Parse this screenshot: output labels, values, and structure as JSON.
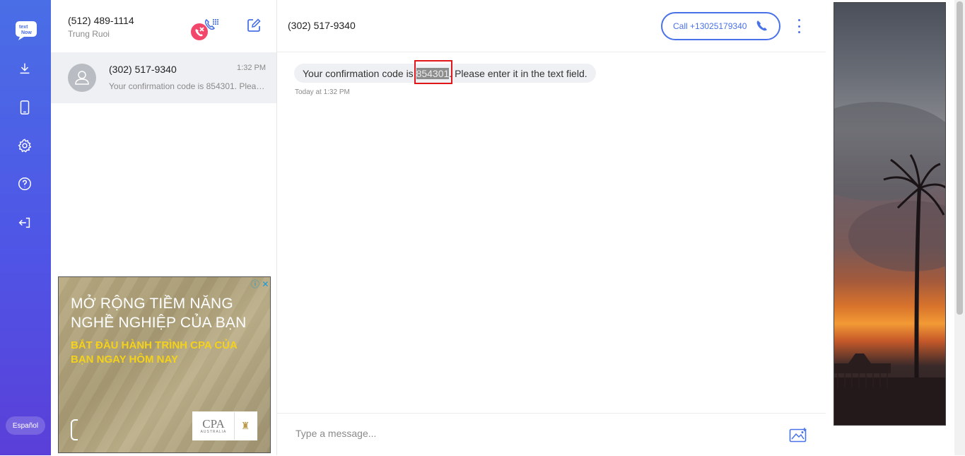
{
  "app": {
    "logo_text": "text Now"
  },
  "rail": {
    "items": [
      {
        "icon": "download-icon"
      },
      {
        "icon": "phone-device-icon"
      },
      {
        "icon": "settings-gear-icon"
      },
      {
        "icon": "help-icon"
      },
      {
        "icon": "logout-icon"
      }
    ],
    "language_label": "Español"
  },
  "account": {
    "number": "(512) 489-1114",
    "name": "Trung Ruoi"
  },
  "conversations": [
    {
      "name": "(302) 517-9340",
      "time": "1:32 PM",
      "preview": "Your confirmation code is 854301. Please enter it in the text field."
    }
  ],
  "ad": {
    "headline": "MỞ RỘNG TIỀM NĂNG NGHỀ NGHIỆP CỦA BẠN",
    "subheadline": "BẮT ĐẦU HÀNH TRÌNH CPA CỦA BẠN NGAY HÔM NAY",
    "brand": "CPA",
    "brand_sub": "AUSTRALIA"
  },
  "chat": {
    "title": "(302) 517-9340",
    "call_label": "Call +13025179340",
    "message": {
      "before": "Your confirmation code is ",
      "code": "854301",
      "after": ". Please enter it in the text field.",
      "timestamp": "Today at 1:32 PM"
    },
    "input_placeholder": "Type a message..."
  },
  "colors": {
    "accent": "#4a72e8",
    "highlight_box": "#e0161b",
    "rail_top": "#4a6ee6",
    "rail_bottom": "#5a3fd8"
  }
}
